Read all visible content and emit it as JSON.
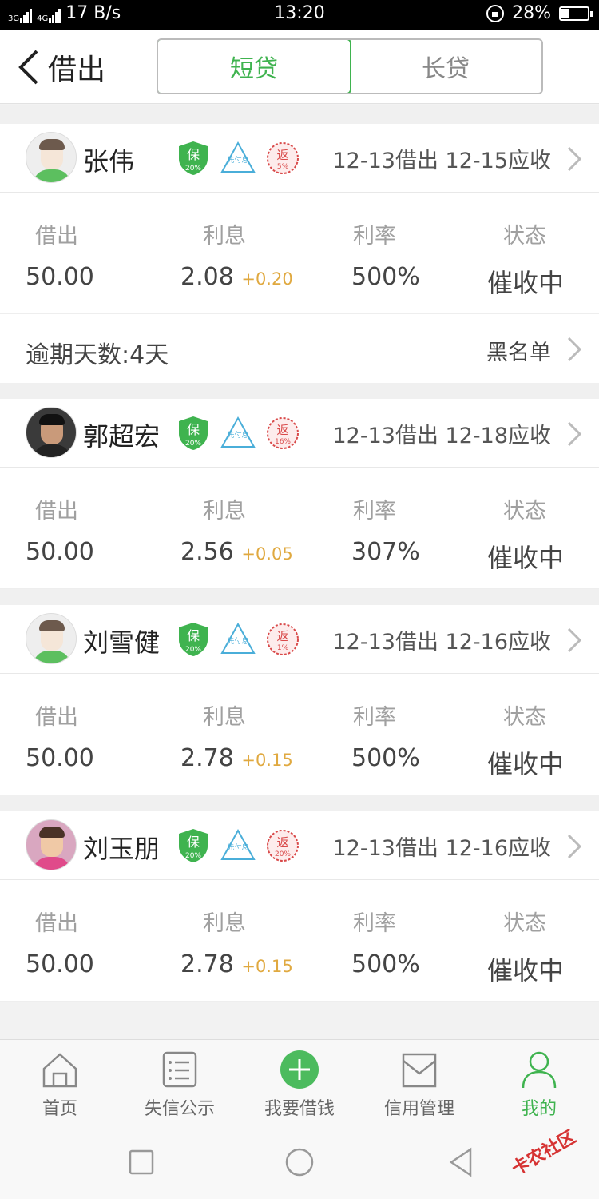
{
  "status_bar": {
    "network_left": "3G",
    "network_right": "4G",
    "speed": "17 B/s",
    "time": "13:20",
    "battery": "28%",
    "battery_level": 0.28
  },
  "header": {
    "title": "借出",
    "tabs": [
      {
        "label": "短贷",
        "active": true
      },
      {
        "label": "长贷",
        "active": false
      }
    ]
  },
  "column_labels": {
    "lent": "借出",
    "interest": "利息",
    "rate": "利率",
    "status": "状态"
  },
  "badges": {
    "bao": "保",
    "bao_pct": "20%",
    "xian": "先付息",
    "fan": "返"
  },
  "loans": [
    {
      "name": "张伟",
      "avatar": "default-avatar",
      "fan_pct": "5%",
      "dates": "12-13借出 12-15应收",
      "lent": "50.00",
      "interest": "2.08",
      "interest_extra": "+0.20",
      "rate": "500%",
      "status": "催收中",
      "overdue": "逾期天数:4天",
      "overdue_action": "黑名单"
    },
    {
      "name": "郭超宏",
      "avatar": "photo-avatar",
      "fan_pct": "16%",
      "dates": "12-13借出 12-18应收",
      "lent": "50.00",
      "interest": "2.56",
      "interest_extra": "+0.05",
      "rate": "307%",
      "status": "催收中"
    },
    {
      "name": "刘雪健",
      "avatar": "default-avatar",
      "fan_pct": "1%",
      "dates": "12-13借出 12-16应收",
      "lent": "50.00",
      "interest": "2.78",
      "interest_extra": "+0.15",
      "rate": "500%",
      "status": "催收中"
    },
    {
      "name": "刘玉朋",
      "avatar": "photo-avatar",
      "fan_pct": "20%",
      "dates": "12-13借出 12-16应收",
      "lent": "50.00",
      "interest": "2.78",
      "interest_extra": "+0.15",
      "rate": "500%",
      "status": "催收中"
    }
  ],
  "bottom_nav": [
    {
      "label": "首页",
      "icon": "home-icon",
      "active": false
    },
    {
      "label": "失信公示",
      "icon": "list-icon",
      "active": false
    },
    {
      "label": "我要借钱",
      "icon": "plus-icon",
      "active": false
    },
    {
      "label": "信用管理",
      "icon": "inbox-icon",
      "active": false
    },
    {
      "label": "我的",
      "icon": "user-icon",
      "active": true
    }
  ],
  "watermark": "卡农社区",
  "colors": {
    "accent": "#3fb34f",
    "interest_extra": "#e0a940",
    "fan_red": "#d94a4a"
  }
}
